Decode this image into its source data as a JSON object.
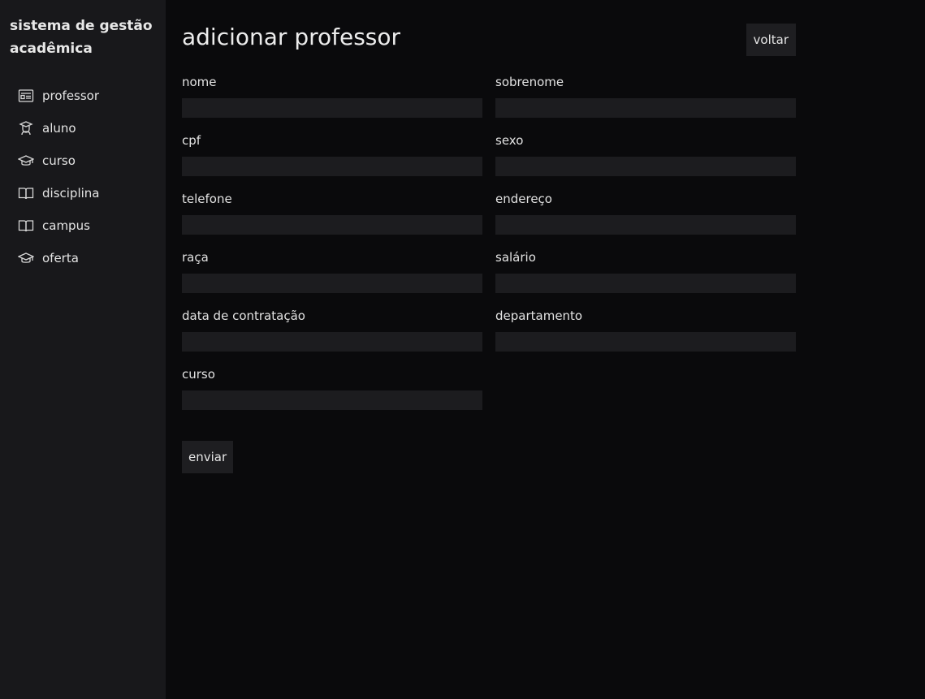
{
  "sidebar": {
    "brand": "sistema de gestão acadêmica",
    "items": [
      {
        "label": "professor",
        "icon": "id-card-icon"
      },
      {
        "label": "aluno",
        "icon": "student-icon"
      },
      {
        "label": "curso",
        "icon": "graduation-cap-icon"
      },
      {
        "label": "disciplina",
        "icon": "book-icon"
      },
      {
        "label": "campus",
        "icon": "book-icon"
      },
      {
        "label": "oferta",
        "icon": "graduation-cap-icon"
      }
    ]
  },
  "header": {
    "title": "adicionar professor",
    "back_label": "voltar"
  },
  "form": {
    "fields": [
      {
        "label": "nome",
        "value": ""
      },
      {
        "label": "sobrenome",
        "value": ""
      },
      {
        "label": "cpf",
        "value": ""
      },
      {
        "label": "sexo",
        "value": ""
      },
      {
        "label": "telefone",
        "value": ""
      },
      {
        "label": "endereço",
        "value": ""
      },
      {
        "label": "raça",
        "value": ""
      },
      {
        "label": "salário",
        "value": ""
      },
      {
        "label": "data de contratação",
        "value": ""
      },
      {
        "label": "departamento",
        "value": ""
      },
      {
        "label": "curso",
        "value": ""
      }
    ],
    "submit_label": "enviar"
  },
  "colors": {
    "background": "#0a0a0c",
    "sidebar": "#18181b",
    "input": "#1c1c1f",
    "button": "#1e1e21",
    "text": "#e6e6e6"
  }
}
